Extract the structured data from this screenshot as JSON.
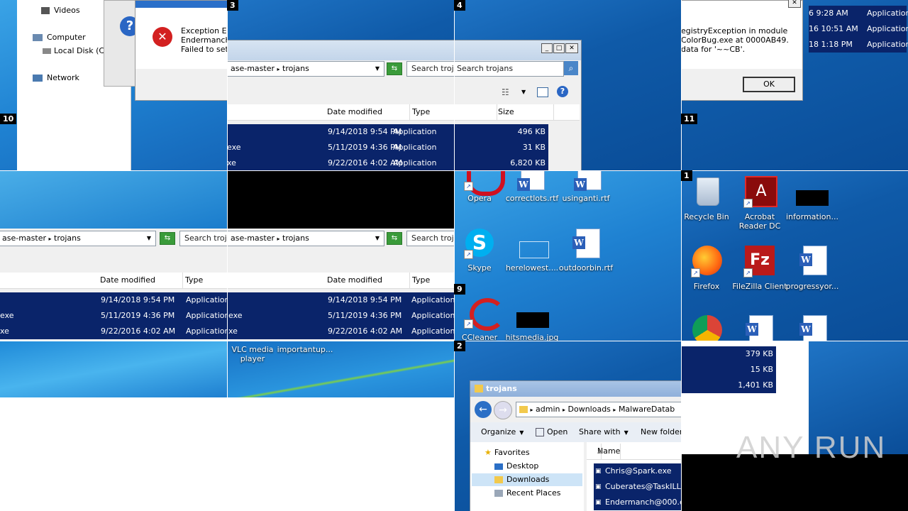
{
  "tile_numbers": {
    "t1": "1",
    "t2": "2",
    "t3": "3",
    "t4": "4",
    "t9": "9",
    "t10": "10",
    "t11": "11"
  },
  "explorer_tree": {
    "videos": "Videos",
    "computer": "Computer",
    "local_disk": "Local Disk (C:)",
    "network": "Network"
  },
  "error_dialog": {
    "line1": "Exception ER",
    "line2": "Endermanch@",
    "line3": "Failed to set c"
  },
  "registry_dialog": {
    "line1": "egistryException in module",
    "line2": "ColorBug.exe at 0000AB49.",
    "line3": "data for '~~CB'.",
    "ok_label": "OK"
  },
  "top_right_rows": [
    {
      "date": "6 9:28 AM",
      "type": "Application"
    },
    {
      "date": "16 10:51 AM",
      "type": "Application"
    },
    {
      "date": "18 1:18 PM",
      "type": "Application"
    }
  ],
  "breadcrumb": {
    "part1": "ase-master",
    "part2": "trojans"
  },
  "search": {
    "placeholder": "Search trojans",
    "placeholder_short": "Search troja"
  },
  "columns": {
    "date_modified": "Date modified",
    "type": "Type",
    "size": "Size",
    "name": "Name"
  },
  "file_rows": [
    {
      "name": "",
      "date": "9/14/2018 9:54 PM",
      "type": "Application",
      "size": "496 KB"
    },
    {
      "name": "exe",
      "date": "5/11/2019 4:36 PM",
      "type": "Application",
      "size": "31 KB"
    },
    {
      "name": "xe",
      "date": "9/22/2016 4:02 AM",
      "type": "Application",
      "size": "6,820 KB"
    }
  ],
  "file_rows_mid": [
    {
      "name": "",
      "date": "9/14/2018 9:54 PM",
      "type": "Application"
    },
    {
      "name": "exe",
      "date": "5/11/2019 4:36 PM",
      "type": "Application"
    },
    {
      "name": "xe",
      "date": "9/22/2016 4:02 AM",
      "type": "Application"
    }
  ],
  "file_rows_mid2": [
    {
      "name": "",
      "date": "9/14/2018 9:54 PM",
      "type": "Application"
    },
    {
      "name": "exe",
      "date": "5/11/2019 4:36 PM",
      "type": "Application"
    },
    {
      "name": "xe",
      "date": "9/22/2016 4:02 AM",
      "type": "Application"
    }
  ],
  "sizes_bottom": [
    "379 KB",
    "15 KB",
    "1,401 KB"
  ],
  "desktop_mid": {
    "opera": "Opera",
    "correctlots": "correctlots.rtf",
    "usinganti": "usinganti.rtf",
    "skype": "Skype",
    "herelowest": "herelowest....",
    "outdoorbin": "outdoorbin.rtf",
    "ccleaner": "CCleaner",
    "hitsmedia": "hitsmedia.jpg"
  },
  "desktop_right": {
    "recycle": "Recycle Bin",
    "acrobat": "Acrobat Reader DC",
    "information": "information...",
    "firefox": "Firefox",
    "filezilla": "FileZilla Client",
    "progressyor": "progressyor..."
  },
  "desktop_bottom": {
    "vlc": "VLC media player",
    "importantup": "importantup..."
  },
  "explorer2": {
    "title": "trojans",
    "crumbs": [
      "admin",
      "Downloads",
      "MalwareDatab"
    ],
    "toolbar": {
      "organize": "Organize",
      "open": "Open",
      "share": "Share with",
      "new_folder": "New folder"
    },
    "nav": {
      "favorites": "Favorites",
      "desktop": "Desktop",
      "downloads": "Downloads",
      "recent": "Recent Places"
    },
    "files": [
      "Chris@Spark.exe",
      "Cuberates@TaskILL",
      "Endermanch@000.e"
    ]
  },
  "watermark": "ANY RUN"
}
